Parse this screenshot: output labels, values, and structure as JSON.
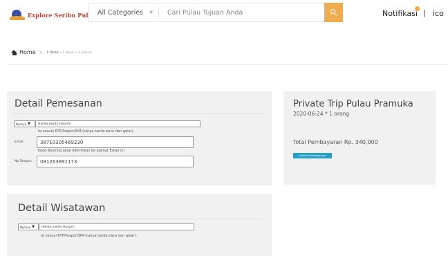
{
  "header": {
    "logo_text": "Explore Seribu Pulau",
    "category_label": "All Categories",
    "search_placeholder": "Cari Pulau Tujuan Anda",
    "notifications_label": "Notifikasi",
    "divider": "|",
    "ico_label": "ico"
  },
  "breadcrumb": {
    "home_label": "Home",
    "separator": ">",
    "step1": "1. Pesan",
    "step2": "2. Bayar",
    "step3": "3. Selesai"
  },
  "order_details": {
    "title": "Detail Pemesanan",
    "title_select": "Nyonya",
    "name_value": "Halida Juwita Hasyim",
    "name_hint": "Isi sesuai KTP/Paspor/SIM (tanpa tanda baca dan gelar).",
    "email_label": "Email",
    "email_value": "38710305469230",
    "email_hint": "Kode Booking akan dikirimkan ke alamat Email ini.",
    "phone_label": "No Telepon",
    "phone_value": "081263891173"
  },
  "trip": {
    "title": "Private Trip Pulau Pramuka",
    "subtitle": "2020-06-24 * 1 orang",
    "total": "Total Pembayaran Rp. 340,000",
    "pay_button": "Lanjut ke Pembayaran"
  },
  "traveler_details": {
    "title": "Detail Wisatawan",
    "title_select": "Nyonya",
    "name_value": "Halida Juwita Hasyim",
    "name_hint": "Isi sesuai KTP/Paspor/SIM (tanpa tanda baca dan gelar)."
  },
  "colors": {
    "accent": "#f0ad4e",
    "button": "#27a1c7",
    "card_bg": "#f1f1f1",
    "logo_text": "#c0392b"
  },
  "icons": [
    "logo-icon",
    "chevron-down-icon",
    "search-icon",
    "notification-dot-icon",
    "home-icon"
  ]
}
